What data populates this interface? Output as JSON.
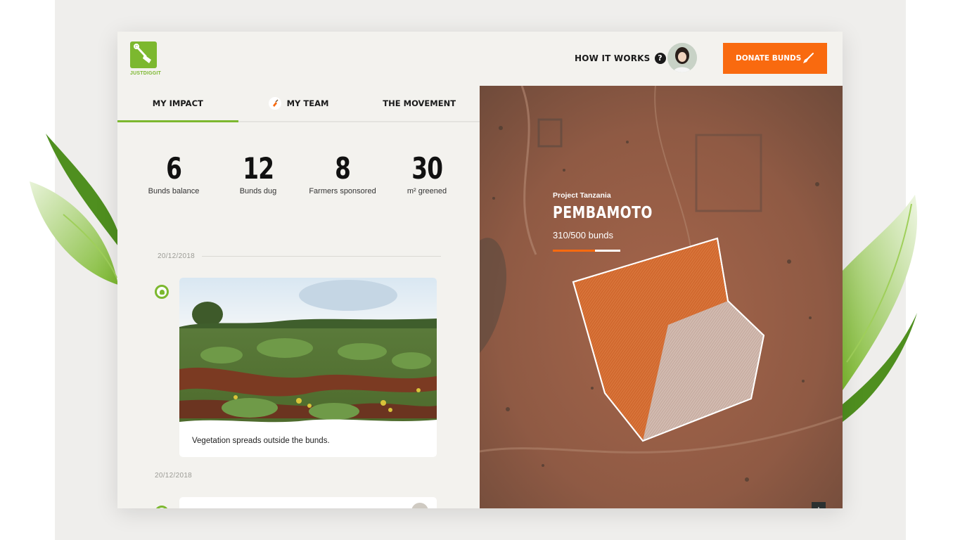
{
  "brand": {
    "logo_text": "JUSTDIGGIT",
    "accent": "#7cb82f",
    "cta_color": "#f96a0f"
  },
  "header": {
    "how_it_works": "HOW IT WORKS",
    "help_icon": "?",
    "donate_label": "DONATE BUNDS"
  },
  "tabs": [
    {
      "label": "MY IMPACT",
      "active": true
    },
    {
      "label": "MY TEAM",
      "active": false
    },
    {
      "label": "THE MOVEMENT",
      "active": false
    }
  ],
  "stats": [
    {
      "value": "6",
      "label": "Bunds balance"
    },
    {
      "value": "12",
      "label": "Bunds dug"
    },
    {
      "value": "8",
      "label": "Farmers sponsored"
    },
    {
      "value": "30",
      "label": "m² greened"
    }
  ],
  "feed": [
    {
      "date": "20/12/2018",
      "caption": "Vegetation spreads outside the bunds."
    },
    {
      "date": "20/12/2018"
    }
  ],
  "project": {
    "subtitle": "Project Tanzania",
    "name": "PEMBAMOTO",
    "count_text": "310/500 bunds",
    "progress": 0.62
  },
  "map": {
    "zoom_in": "+"
  }
}
